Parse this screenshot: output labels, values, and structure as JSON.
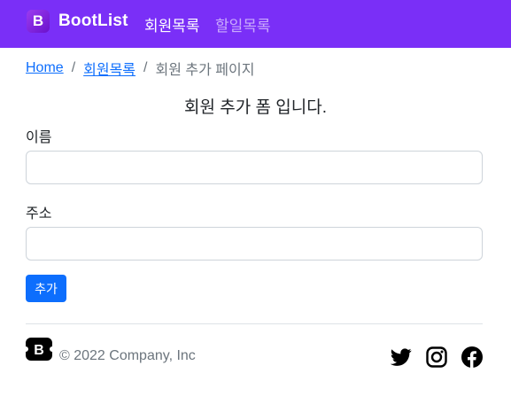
{
  "navbar": {
    "brand_logo_letter": "B",
    "brand_name": "BootList",
    "links": [
      {
        "label": "회원목록",
        "active": true
      },
      {
        "label": "할일목록",
        "active": false
      }
    ],
    "background": "#7a2ff7"
  },
  "breadcrumb": {
    "home": "Home",
    "members": "회원목록",
    "current": "회원 추가 페이지",
    "separator": "/"
  },
  "form": {
    "title": "회원 추가 폼 입니다.",
    "name_label": "이름",
    "name_value": "",
    "address_label": "주소",
    "address_value": "",
    "submit_label": "추가",
    "submit_color": "#0d6efd"
  },
  "footer": {
    "logo_letter": "B",
    "copyright": "© 2022 Company, Inc",
    "social_icons": [
      "twitter-icon",
      "instagram-icon",
      "facebook-icon"
    ]
  }
}
